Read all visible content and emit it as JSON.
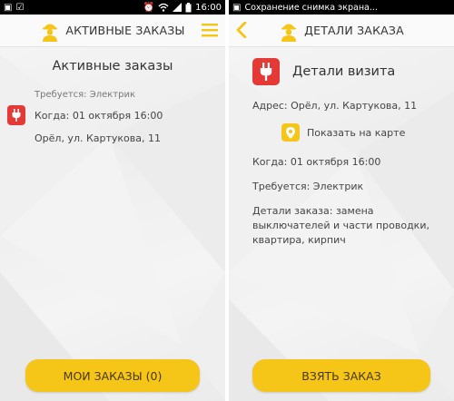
{
  "left_screen": {
    "status_bar": {
      "time": "16:00"
    },
    "app_bar": {
      "title": "АКТИВНЫЕ ЗАКАЗЫ"
    },
    "heading": "Активные заказы",
    "order": {
      "required": "Требуется: Электрик",
      "when": "Когда: 01 октября 16:00",
      "address": "Орёл, ул. Картукова, 11"
    },
    "button": {
      "label": "МОИ ЗАКАЗЫ (0)"
    }
  },
  "right_screen": {
    "status_bar": {
      "text": "Сохранение снимка экрана..."
    },
    "app_bar": {
      "title": "ДЕТАЛИ ЗАКАЗА"
    },
    "heading": "Детали визита",
    "address": "Адрес: Орёл, ул. Картукова, 11",
    "map_link": "Показать на карте",
    "when": "Когда: 01 октября 16:00",
    "required": "Требуется: Электрик",
    "details": "Детали заказа: замена выключателей и части проводки, квартира, кирпич",
    "button": {
      "label": "ВЗЯТЬ ЗАКАЗ"
    }
  },
  "colors": {
    "accent": "#f5c518",
    "badge": "#e53935",
    "statusbar": "#000000"
  },
  "icons": [
    "worker-logo-icon",
    "menu-icon",
    "back-chevron-icon",
    "plug-icon",
    "map-pin-icon",
    "wifi-icon",
    "battery-icon",
    "alarm-icon"
  ]
}
